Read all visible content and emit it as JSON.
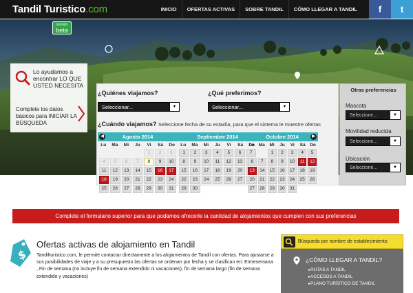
{
  "header": {
    "logo_main": "Tandil Turistico",
    "logo_tld": ".com",
    "beta_small": "Versión",
    "beta_label": "beta",
    "nav": [
      "INICIO",
      "OFERTAS ACTIVAS",
      "SOBRE TANDIL",
      "CÓMO LLEGAR A TANDIL"
    ],
    "social": {
      "facebook": "f",
      "twitter": "t",
      "facebook_color": "#3a5998",
      "twitter_color": "#3aa0d6"
    }
  },
  "hero": {
    "help_text": "Lo ayudamos a encontrar LO QUE USTED NECESITA",
    "complete_text": "Complete los datos básicos para INICIAR LA BÚSQUEDA"
  },
  "search_form": {
    "who": {
      "label": "¿Quiénes viajamos?",
      "value": "Seleccionar..."
    },
    "prefer": {
      "label": "¿Qué preferimos?",
      "value": "Seleccionar..."
    },
    "when": {
      "label": "¿Cuándo viajamos?",
      "hint": "Seleccione fecha de su estadía, para que el sistema le muestre ofertas"
    },
    "weekdays": [
      "Lu",
      "Ma",
      "Mi",
      "Ju",
      "Vi",
      "Sá",
      "Do"
    ],
    "months": [
      {
        "name": "Agosto 2014",
        "offset": 4,
        "days": 31,
        "today": 8,
        "past_until": 7,
        "red": [
          16,
          17,
          18
        ]
      },
      {
        "name": "Septiembre 2014",
        "offset": 0,
        "days": 30,
        "today": 0,
        "past_until": 0,
        "red": []
      },
      {
        "name": "Octubre 2014",
        "offset": 2,
        "days": 31,
        "today": 0,
        "past_until": 0,
        "red": [
          11,
          12,
          13
        ]
      }
    ]
  },
  "preferences": {
    "title": "Otras preferencias",
    "items": [
      {
        "label": "Mascota",
        "value": "Seleccione..."
      },
      {
        "label": "Movilidad reducida",
        "value": "Seleccione..."
      },
      {
        "label": "Ubicación",
        "value": "Seleccione..."
      }
    ]
  },
  "alert": {
    "text": "Complete el formulario superior para que podamos ofrecerle la cantidad de alojamientos que cumplen con sus preferencias",
    "color": "#c61c1c"
  },
  "offers": {
    "title": "Ofertas activas de alojamiento en Tandil",
    "body": "Tandilturistico.com, le permite contactar directamente a los alojamientos de Tandil con ofertas. Para ajustarse a sus posibilidades de viaje y a su presupuesto las ofertas se ordenan por fecha y se clasifican en: Entresemana , Fin de semana (no incluye fin de semana extendido ni vacaciones), fin de semana largo (fin de semana extendido y vacaciones)"
  },
  "sidebar": {
    "search_label": "Búsqueda por nombre de establecimiento",
    "howto_title": "¿CÓMO LLEGAR A TANDIL?",
    "links": [
      "RUTAS A TANDIL",
      "ACCESOS A TANDIL",
      "PLANO TURÍSTICO DE TANDIL"
    ],
    "search_color": "#f5dc30"
  }
}
